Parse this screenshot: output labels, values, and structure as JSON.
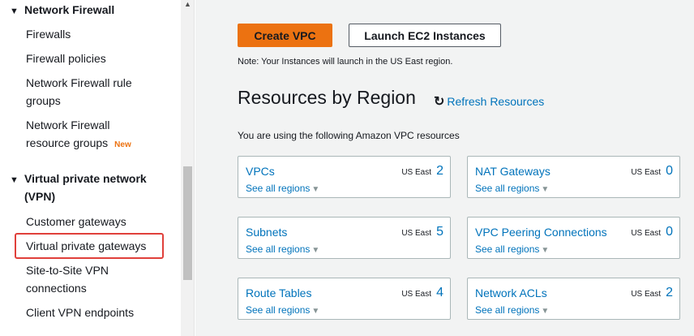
{
  "sidebar": {
    "sections": [
      {
        "title": "Network Firewall"
      },
      {
        "title_line1": "Virtual private network",
        "title_line2": "(VPN)"
      }
    ],
    "items": {
      "firewalls": "Firewalls",
      "firewall_policies": "Firewall policies",
      "nfw_rule_groups_l1": "Network Firewall rule",
      "nfw_rule_groups_l2": "groups",
      "nfw_resource_groups_l1": "Network Firewall",
      "nfw_resource_groups_l2": "resource groups",
      "new_badge": "New",
      "customer_gateways": "Customer gateways",
      "virtual_private_gateways": "Virtual private gateways",
      "s2s_vpn_l1": "Site-to-Site VPN",
      "s2s_vpn_l2": "connections",
      "client_vpn": "Client VPN endpoints"
    },
    "highlight_color": "#e0403b"
  },
  "main": {
    "create_vpc": "Create VPC",
    "launch_ec2": "Launch EC2 Instances",
    "note": "Note: Your Instances will launch in the US East region.",
    "title": "Resources by Region",
    "refresh": "Refresh Resources",
    "using_text": "You are using the following Amazon VPC resources",
    "see_all": "See all regions",
    "cards": [
      {
        "name": "VPCs",
        "region": "US East",
        "count": "2"
      },
      {
        "name": "NAT Gateways",
        "region": "US East",
        "count": "0"
      },
      {
        "name": "Subnets",
        "region": "US East",
        "count": "5"
      },
      {
        "name": "VPC Peering Connections",
        "region": "US East",
        "count": "0"
      },
      {
        "name": "Route Tables",
        "region": "US East",
        "count": "4"
      },
      {
        "name": "Network ACLs",
        "region": "US East",
        "count": "2"
      }
    ]
  },
  "colors": {
    "accent": "#ec7211",
    "link": "#0073bb",
    "background": "#f2f3f3"
  }
}
